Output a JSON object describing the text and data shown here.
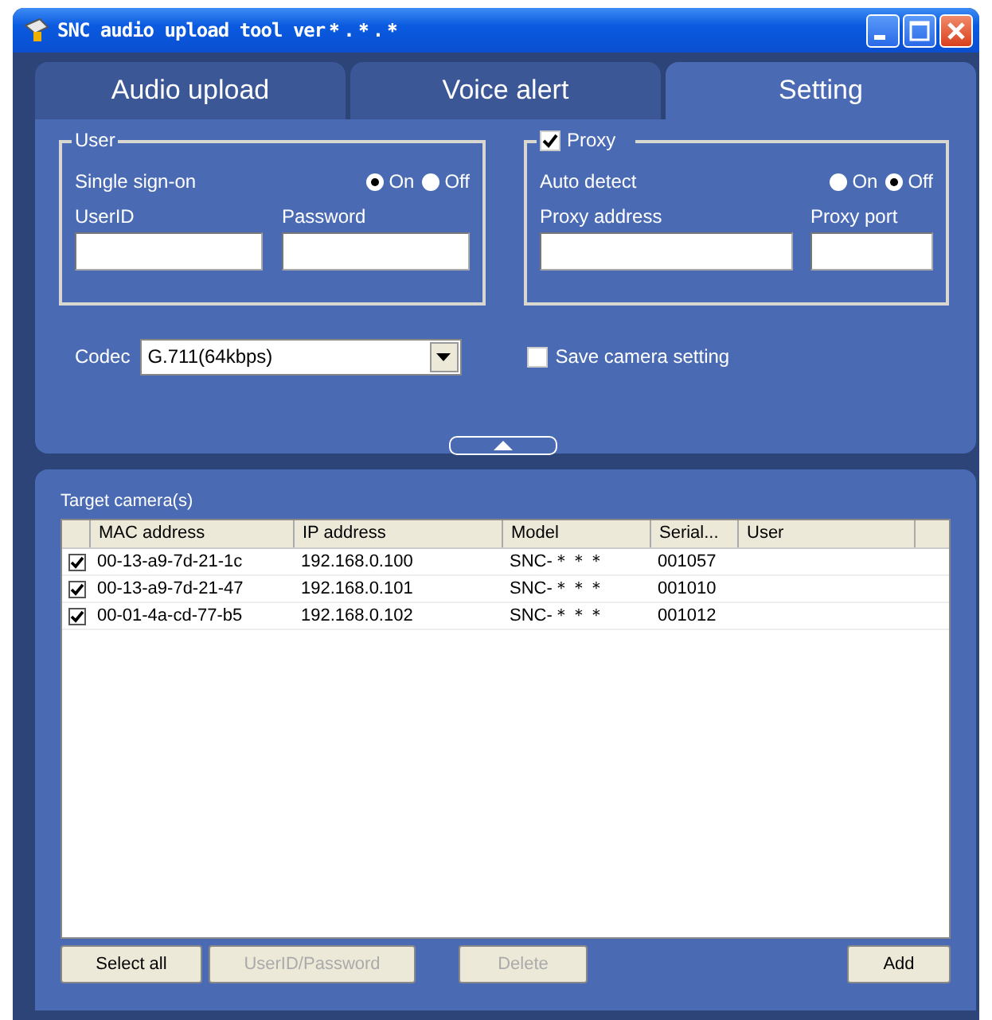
{
  "window": {
    "title": "SNC audio upload tool ver＊.＊.＊"
  },
  "tabs": [
    {
      "label": "Audio upload",
      "selected": false
    },
    {
      "label": "Voice alert",
      "selected": false
    },
    {
      "label": "Setting",
      "selected": true
    }
  ],
  "user": {
    "legend": "User",
    "single_sign_on": {
      "label": "Single sign-on",
      "options": [
        {
          "label": "On",
          "selected": true
        },
        {
          "label": "Off",
          "selected": false
        }
      ]
    },
    "userid_label": "UserID",
    "password_label": "Password"
  },
  "proxy": {
    "label": "Proxy",
    "checked": true,
    "auto_detect": {
      "label": "Auto detect",
      "options": [
        {
          "label": "On",
          "selected": false
        },
        {
          "label": "Off",
          "selected": true
        }
      ]
    },
    "address_label": "Proxy address",
    "port_label": "Proxy port"
  },
  "codec": {
    "label": "Codec",
    "value": "G.711(64kbps)"
  },
  "save_camera_setting": {
    "label": "Save camera setting",
    "checked": false
  },
  "target": {
    "label": "Target camera(s)",
    "columns": [
      "MAC address",
      "IP address",
      "Model",
      "Serial...",
      "User"
    ],
    "rows": [
      {
        "checked": true,
        "cells": [
          "00-13-a9-7d-21-1c",
          "192.168.0.100",
          "SNC-＊＊＊",
          "001057"
        ]
      },
      {
        "checked": true,
        "cells": [
          "00-13-a9-7d-21-47",
          "192.168.0.101",
          "SNC-＊＊＊",
          "001010"
        ]
      },
      {
        "checked": true,
        "cells": [
          "00-01-4a-cd-77-b5",
          "192.168.0.102",
          "SNC-＊＊＊",
          "001012"
        ]
      }
    ]
  },
  "buttons": [
    {
      "label": "Select all",
      "disabled": false
    },
    {
      "label": "UserID/Password",
      "disabled": true
    },
    {
      "label": "Delete",
      "disabled": true
    },
    {
      "label": "Add",
      "disabled": false
    }
  ]
}
